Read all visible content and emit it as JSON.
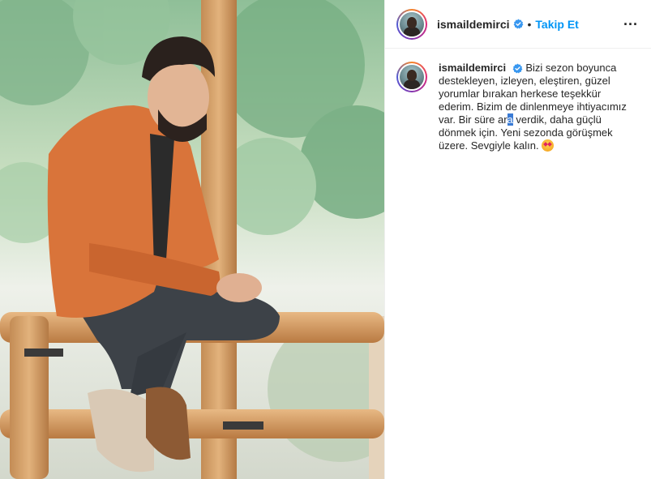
{
  "post": {
    "image_alt": "Photo of a man in an orange shirt sitting on a wooden railing with green forest behind",
    "username": "ismaildemirci",
    "separator": "•",
    "follow_label": "Takip Et",
    "more_icon": "more-options-icon",
    "verified_icon": "verified-badge-icon"
  },
  "caption": {
    "username": "ismaildemirci",
    "text_before": "Bizi sezon boyunca destekleyen, izleyen, eleştiren, güzel yorumlar bırakan herkese teşekkür ederim. Bizim de dinlenmeye ihtiyacımız var. Bir süre ar",
    "text_highlight": "a",
    "text_after": " verdik, daha güçlü dönmek için. Yeni sezonda görüşmek üzere. Sevgiyle kalın. ",
    "emoji": "star-struck-emoji"
  },
  "colors": {
    "accent": "#0095f6",
    "verified": "#3897f0",
    "selection": "#3a7bd5",
    "shirt": "#d9743a"
  }
}
